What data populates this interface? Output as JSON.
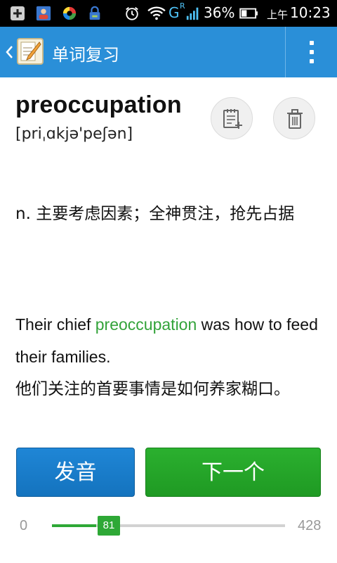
{
  "status_bar": {
    "signal_label": "G",
    "signal_sub": "R",
    "battery": "36%",
    "time_prefix": "上午",
    "time": "10:23"
  },
  "app_bar": {
    "title": "单词复习"
  },
  "word": {
    "text": "preoccupation",
    "phonetic": "[priˌɑkjə'peʃən]"
  },
  "definition": "n. 主要考虑因素；全神贯注，抢先占据",
  "example": {
    "before": "Their chief ",
    "highlight": "preoccupation",
    "after": " was how to feed their families."
  },
  "translation": "他们关注的首要事情是如何养家糊口。",
  "buttons": {
    "pronounce": "发音",
    "next": "下一个"
  },
  "progress": {
    "min": "0",
    "max": "428",
    "current": "81",
    "value": 81,
    "total": 428
  },
  "colors": {
    "app_bar": "#2a8fd8",
    "highlight": "#33a33a",
    "pronounce_button": "#1a7ecb",
    "next_button": "#24a428"
  },
  "icons": {
    "add_to_notebook": "notebook-add-icon",
    "delete": "trash-icon"
  }
}
